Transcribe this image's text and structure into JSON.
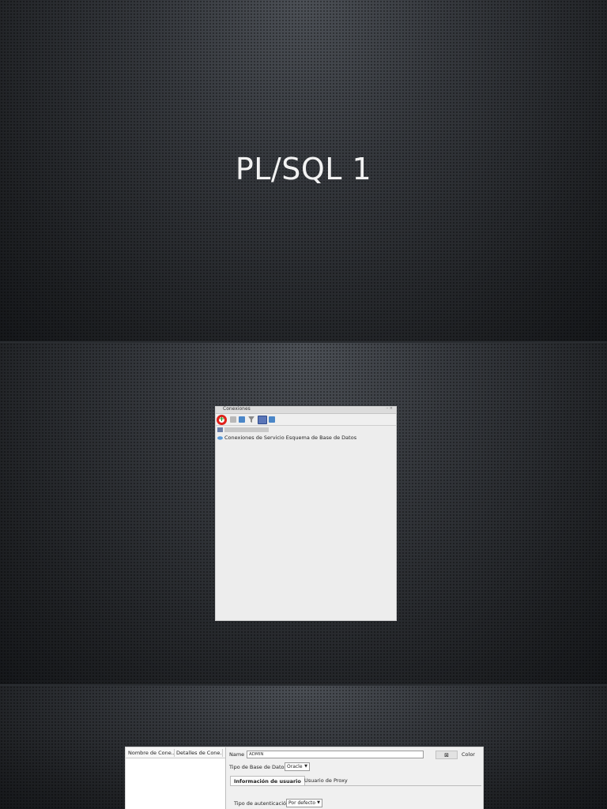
{
  "slides": [
    {
      "title": "PL/SQL 1"
    },
    {
      "panel": {
        "title": "Conexiones",
        "selected_item": "Nueva Conexión...",
        "tree_item": "Conexiones de Servicio Esquema de Base de Datos"
      }
    },
    {
      "dialog": {
        "columns": [
          "Nombre de Cone...",
          "Detalles de Cone..."
        ],
        "name_label": "Name",
        "name_value": "ADMIN",
        "color_label": "Color",
        "db_type_label": "Tipo de Base de Datos",
        "db_type_value": "Oracle",
        "tabs": [
          "Información de usuario",
          "Usuario de Proxy"
        ],
        "auth_label": "Tipo de autenticación",
        "auth_value": "Por defecto"
      }
    }
  ],
  "colors": {
    "highlight_ring": "#e0201a",
    "add_icon": "#1c9a2a"
  }
}
